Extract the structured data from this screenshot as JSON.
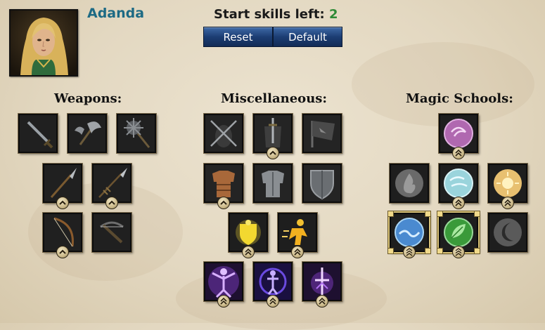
{
  "hero": {
    "name": "Adanda"
  },
  "start_skills": {
    "label": "Start skills left:",
    "count": "2"
  },
  "buttons": {
    "reset": "Reset",
    "default": "Default"
  },
  "sections": {
    "weapons": "Weapons:",
    "misc": "Miscellaneous:",
    "magic": "Magic Schools:"
  },
  "colors": {
    "name": "#1d6a84",
    "count": "#2e8a36",
    "button": "#1c3d73"
  },
  "skills": {
    "weapons": [
      {
        "icon": "sword-icon",
        "level": 0
      },
      {
        "icon": "axe-icon",
        "level": 0
      },
      {
        "icon": "mace-icon",
        "level": 0
      },
      {
        "icon": "spear-icon",
        "level": 1
      },
      {
        "icon": "javelin-icon",
        "level": 1
      },
      {
        "icon": "bow-icon",
        "level": 1
      },
      {
        "icon": "crossbow-icon",
        "level": 0
      }
    ],
    "misc": [
      {
        "icon": "dual-wield-icon",
        "level": 0
      },
      {
        "icon": "sword-armor-icon",
        "level": 1
      },
      {
        "icon": "banner-icon",
        "level": 0
      },
      {
        "icon": "leather-armor-icon",
        "level": 1
      },
      {
        "icon": "plate-armor-icon",
        "level": 0
      },
      {
        "icon": "shield-icon",
        "level": 0
      },
      {
        "icon": "guard-icon",
        "level": 2
      },
      {
        "icon": "dodge-icon",
        "level": 2
      },
      {
        "icon": "meditation-icon",
        "level": 2
      },
      {
        "icon": "bodybuilding-icon",
        "level": 2
      },
      {
        "icon": "regeneration-icon",
        "level": 2
      }
    ],
    "magic": [
      {
        "icon": "spirit-magic-icon",
        "level": 2,
        "selected": false
      },
      {
        "icon": "fire-magic-icon",
        "level": 0,
        "selected": false
      },
      {
        "icon": "air-magic-icon",
        "level": 2,
        "selected": false
      },
      {
        "icon": "light-magic-icon",
        "level": 2,
        "selected": false
      },
      {
        "icon": "water-magic-icon",
        "level": 3,
        "selected": true
      },
      {
        "icon": "earth-magic-icon",
        "level": 3,
        "selected": true
      },
      {
        "icon": "dark-magic-icon",
        "level": 0,
        "selected": false
      }
    ]
  }
}
